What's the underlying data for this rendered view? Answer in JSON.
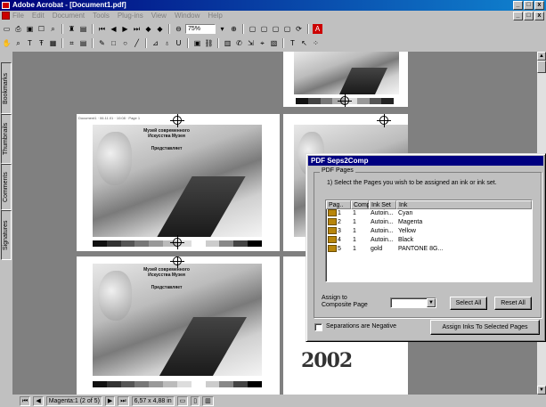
{
  "app": {
    "title": "Adobe Acrobat - [Document1.pdf]",
    "window_buttons": [
      "_",
      "□",
      "x"
    ],
    "doc_buttons": [
      "_",
      "□",
      "x"
    ]
  },
  "menu": [
    "File",
    "Edit",
    "Document",
    "Tools",
    "Plug-ins",
    "View",
    "Window",
    "Help"
  ],
  "toolbar": {
    "zoom_value": "75%",
    "row1_icons": [
      "open-icon",
      "print-icon",
      "save-icon",
      "hand-icon",
      "zoom-icon",
      "text-select-icon",
      "find-icon",
      "first-page-icon",
      "prev-page-icon",
      "next-page-icon",
      "last-page-icon",
      "go-back-icon",
      "go-forward-icon",
      "zoom-out-icon",
      "zoom-in-icon",
      "actual-size-icon",
      "fit-page-icon",
      "fit-width-icon",
      "acrobat-logo-icon"
    ],
    "row2_icons": [
      "hand-tool-icon",
      "zoom-tool-icon",
      "text-tool-icon",
      "column-tool-icon",
      "table-tool-icon",
      "crop-icon",
      "form-icon",
      "note-icon",
      "pencil-icon",
      "rect-icon",
      "oval-icon",
      "line-icon",
      "highlight-icon",
      "stamp-icon",
      "movie-icon",
      "link-icon",
      "article-icon",
      "touchup-icon",
      "select-icon",
      "graphics-icon"
    ]
  },
  "side_tabs": [
    "Bookmarks",
    "Thumbnails",
    "Comments",
    "Signatures"
  ],
  "pages": [
    {
      "id": "p1",
      "headline": "",
      "footer": ""
    },
    {
      "id": "p2",
      "headline": "Музей современного Искусства Музея",
      "subline": "Представляет",
      "footer": ""
    },
    {
      "id": "p3",
      "headline": "",
      "footer": ""
    },
    {
      "id": "p4",
      "headline": "Музей современного Искусства Музея",
      "subline": "Представляет",
      "footer": ""
    },
    {
      "id": "p5",
      "logo_text": "2002"
    }
  ],
  "dialog": {
    "title": "PDF Seps2Comp",
    "group_label": "PDF Pages",
    "instruction": "1) Select the Pages you wish to be assigned an ink or ink set.",
    "columns": [
      "Pag..",
      "Comp",
      "Ink Set",
      "Ink"
    ],
    "rows": [
      {
        "page": "1",
        "comp": "1",
        "ink_set": "Autoin...",
        "ink": "Cyan"
      },
      {
        "page": "2",
        "comp": "1",
        "ink_set": "Autoin...",
        "ink": "Magenta"
      },
      {
        "page": "3",
        "comp": "1",
        "ink_set": "Autoin...",
        "ink": "Yellow"
      },
      {
        "page": "4",
        "comp": "1",
        "ink_set": "Autoin...",
        "ink": "Black"
      },
      {
        "page": "5",
        "comp": "1",
        "ink_set": "gold",
        "ink": "PANTONE 8G..."
      }
    ],
    "assign_label_line1": "Assign to",
    "assign_label_line2": "Composite Page",
    "composite_value": "",
    "select_all": "Select All",
    "reset_all": "Reset All",
    "separations_negative": "Separations are Negative",
    "assign_button": "Assign Inks To Selected Pages"
  },
  "status": {
    "page_indicator": "Magenta:1 (2 of 5)",
    "page_size": "6,57 x 4,88 in"
  }
}
